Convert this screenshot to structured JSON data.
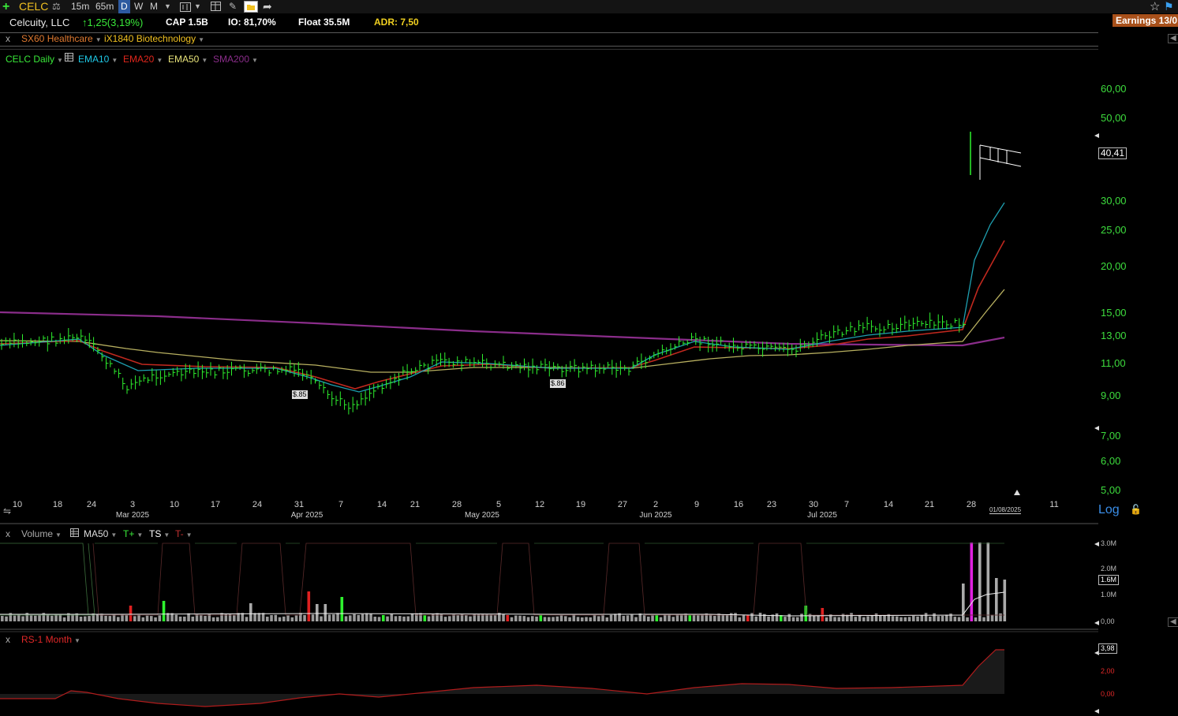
{
  "toolbar": {
    "symbol": "CELC",
    "intervals": [
      "15m",
      "65m",
      "D",
      "W",
      "M"
    ],
    "active_interval": "D"
  },
  "info": {
    "company": "Celcuity, LLC",
    "change": "1,25(3,19%)",
    "cap": "CAP 1.5B",
    "io": "IO: 81,70%",
    "float": "Float 35.5M",
    "adr": "ADR: 7,50",
    "earnings": "Earnings 13/0"
  },
  "groups": {
    "close": "x",
    "sector": "SX60 Healthcare",
    "industry": "iX1840 Biotechnology"
  },
  "legend": {
    "symbol": "CELC Daily",
    "items": [
      {
        "label": "EMA10",
        "color": "#1ec8e6"
      },
      {
        "label": "EMA20",
        "color": "#e0261c"
      },
      {
        "label": "EMA50",
        "color": "#e8e37a"
      },
      {
        "label": "SMA200",
        "color": "#8b2d8b"
      }
    ]
  },
  "price_axis": {
    "labels": [
      "60,00",
      "50,00",
      "40,41",
      "30,00",
      "25,00",
      "20,00",
      "15,00",
      "13,00",
      "11,00",
      "9,00",
      "7,00",
      "6,00",
      "5,00"
    ],
    "current": "40,41",
    "scale": "Log"
  },
  "date_axis": {
    "days": [
      "10",
      "18",
      "24",
      "3",
      "10",
      "17",
      "24",
      "31",
      "7",
      "14",
      "21",
      "28",
      "5",
      "12",
      "19",
      "27",
      "2",
      "9",
      "16",
      "23",
      "30",
      "7",
      "14",
      "21",
      "28",
      "11"
    ],
    "months": [
      "Mar 2025",
      "Apr 2025",
      "May 2025",
      "Jun 2025",
      "Jul 2025"
    ],
    "cursor_date": "01/08/2025"
  },
  "annotations": [
    "$.85",
    "$.86"
  ],
  "volume_panel": {
    "close": "x",
    "title": "Volume",
    "ma": "MA50",
    "flags": [
      "T+",
      "TS",
      "T-"
    ],
    "axis": [
      "3.0M",
      "2.0M",
      "1.6M",
      "1.0M",
      "0,00"
    ],
    "current": "1.6M"
  },
  "rs_panel": {
    "close": "x",
    "title": "RS-1 Month",
    "axis": [
      "3,98",
      "2,00",
      "0,00"
    ],
    "current": "3,98"
  },
  "colors": {
    "up": "#2ef22e",
    "price_label": "#3ddc3d",
    "ema10": "#1ec8e6",
    "ema20": "#e0261c",
    "ema50": "#e8e37a",
    "sma200": "#8b2d8b",
    "earnings_bg": "#a8501a",
    "rs_line": "#b01c1c"
  }
}
